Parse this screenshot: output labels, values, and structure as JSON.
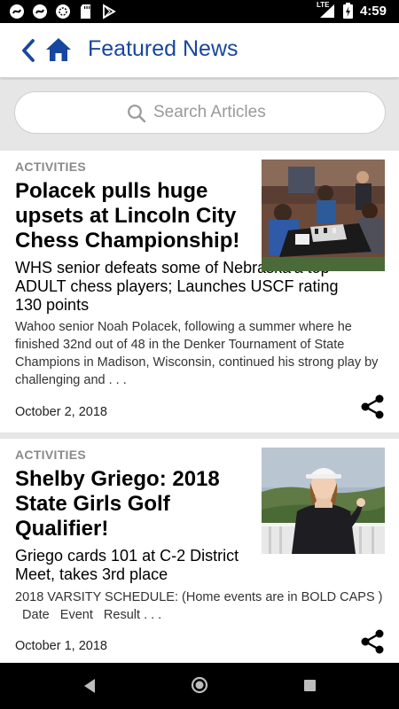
{
  "status_bar": {
    "time": "4:59",
    "network": "LTE",
    "icons": [
      "swirl-app-icon",
      "swirl-app-icon",
      "circle-app-icon",
      "sd-card-icon",
      "play-store-icon",
      "signal-icon",
      "battery-charging-icon"
    ]
  },
  "app_bar": {
    "title": "Featured News",
    "accent_color": "#17479e",
    "back_icon": "chevron-left-icon",
    "home_icon": "home-icon"
  },
  "search": {
    "placeholder": "Search Articles",
    "value": "",
    "icon": "search-icon"
  },
  "articles": [
    {
      "category": "ACTIVITIES",
      "headline": "Polacek pulls huge upsets at Lincoln City Chess Championship!",
      "subhead": "WHS senior defeats some of Nebraska'a top ADULT chess players; Launches USCF rating 130 points",
      "excerpt": "Wahoo senior Noah Polacek, following a summer where he finished 32nd out of 48 in the Denker Tournament of State Champions in Madison, Wisconsin, continued his strong play by challenging and . . .",
      "date": "October 2, 2018",
      "image": "chess-tournament-photo",
      "share_icon": "share-icon"
    },
    {
      "category": "ACTIVITIES",
      "headline": "Shelby Griego: 2018 State Girls Golf Qualifier!",
      "subhead": "Griego cards 101 at C-2 District Meet, takes 3rd place",
      "excerpt_line1": "2018 VARSITY SCHEDULE: (Home events are in BOLD CAPS )",
      "excerpt_line2": "  Date   Event   Result . . .",
      "date": "October 1, 2018",
      "image": "golfer-portrait-photo",
      "share_icon": "share-icon"
    }
  ],
  "nav_bar": {
    "icons": [
      "nav-back-icon",
      "nav-home-icon",
      "nav-recents-icon"
    ]
  }
}
